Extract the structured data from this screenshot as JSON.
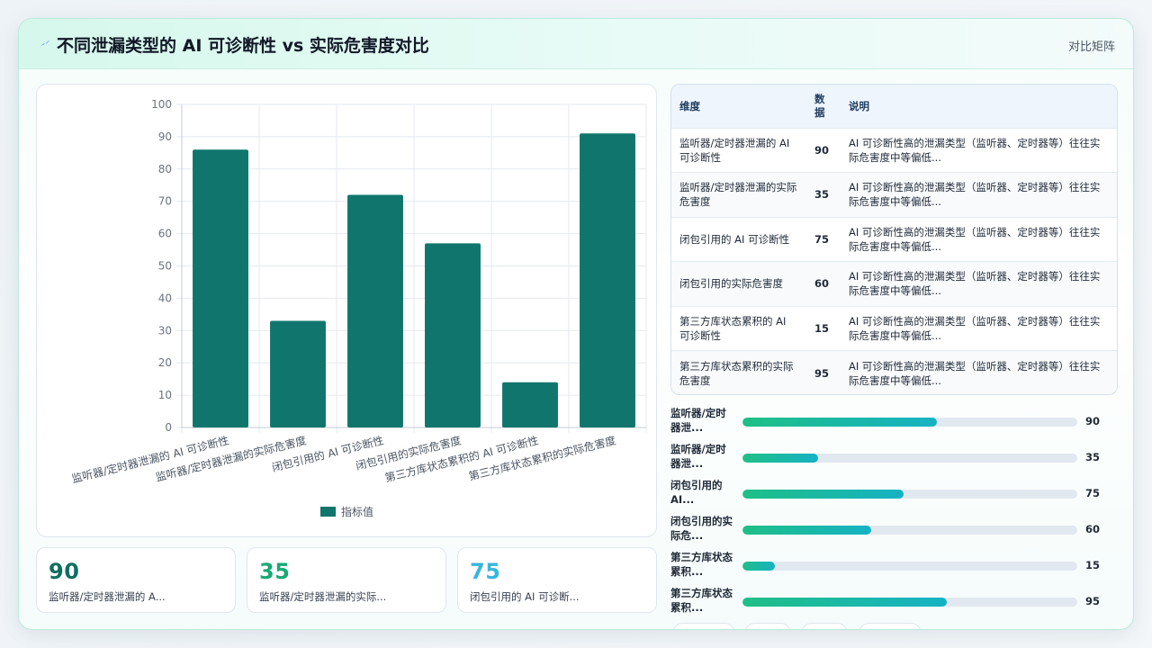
{
  "header": {
    "icon": "lightning-icon",
    "title": "不同泄漏类型的 AI 可诊断性 vs 实际危害度对比",
    "tag": "对比矩阵"
  },
  "colors": {
    "bar": "#10766d",
    "accent_green": "#18a975",
    "accent_cyan": "#38b6e0",
    "kpi_dark": "#0f6f5f"
  },
  "chart_data": {
    "type": "bar",
    "categories": [
      "监听器/定时器泄漏的 AI 可诊断性",
      "监听器/定时器泄漏的实际危害度",
      "闭包引用的 AI 可诊断性",
      "闭包引用的实际危害度",
      "第三方库状态累积的 AI 可诊断性",
      "第三方库状态累积的实际危害度"
    ],
    "series": [
      {
        "name": "指标值",
        "values": [
          86,
          33,
          72,
          57,
          14,
          91
        ]
      }
    ],
    "ylim": [
      0,
      100
    ],
    "yticks": [
      0,
      10,
      20,
      30,
      40,
      50,
      60,
      70,
      80,
      90,
      100
    ],
    "grid": true,
    "legend": "bottom",
    "title": "",
    "xlabel": "",
    "ylabel": ""
  },
  "kpis": [
    {
      "value": "90",
      "label": "监听器/定时器泄漏的 A..."
    },
    {
      "value": "35",
      "label": "监听器/定时器泄漏的实际..."
    },
    {
      "value": "75",
      "label": "闭包引用的 AI 可诊断..."
    }
  ],
  "table": {
    "headers": [
      "维度",
      "数据",
      "说明"
    ],
    "rows": [
      {
        "dim": "监听器/定时器泄漏的 AI 可诊断性",
        "value": "90",
        "note": "AI 可诊断性高的泄漏类型（监听器、定时器等）往往实际危害度中等偏低..."
      },
      {
        "dim": "监听器/定时器泄漏的实际危害度",
        "value": "35",
        "note": "AI 可诊断性高的泄漏类型（监听器、定时器等）往往实际危害度中等偏低..."
      },
      {
        "dim": "闭包引用的 AI 可诊断性",
        "value": "75",
        "note": "AI 可诊断性高的泄漏类型（监听器、定时器等）往往实际危害度中等偏低..."
      },
      {
        "dim": "闭包引用的实际危害度",
        "value": "60",
        "note": "AI 可诊断性高的泄漏类型（监听器、定时器等）往往实际危害度中等偏低..."
      },
      {
        "dim": "第三方库状态累积的 AI 可诊断性",
        "value": "15",
        "note": "AI 可诊断性高的泄漏类型（监听器、定时器等）往往实际危害度中等偏低..."
      },
      {
        "dim": "第三方库状态累积的实际危害度",
        "value": "95",
        "note": "AI 可诊断性高的泄漏类型（监听器、定时器等）往往实际危害度中等偏低..."
      }
    ]
  },
  "progress": [
    {
      "label": "监听器/定时器泄...",
      "value": "90",
      "percent": 58
    },
    {
      "label": "监听器/定时器泄...",
      "value": "35",
      "percent": 22.5
    },
    {
      "label": "闭包引用的AI...",
      "value": "75",
      "percent": 48
    },
    {
      "label": "闭包引用的实际危...",
      "value": "60",
      "percent": 38.5
    },
    {
      "label": "第三方库状态累积...",
      "value": "15",
      "percent": 9.7
    },
    {
      "label": "第三方库状态累积...",
      "value": "95",
      "percent": 61
    }
  ]
}
